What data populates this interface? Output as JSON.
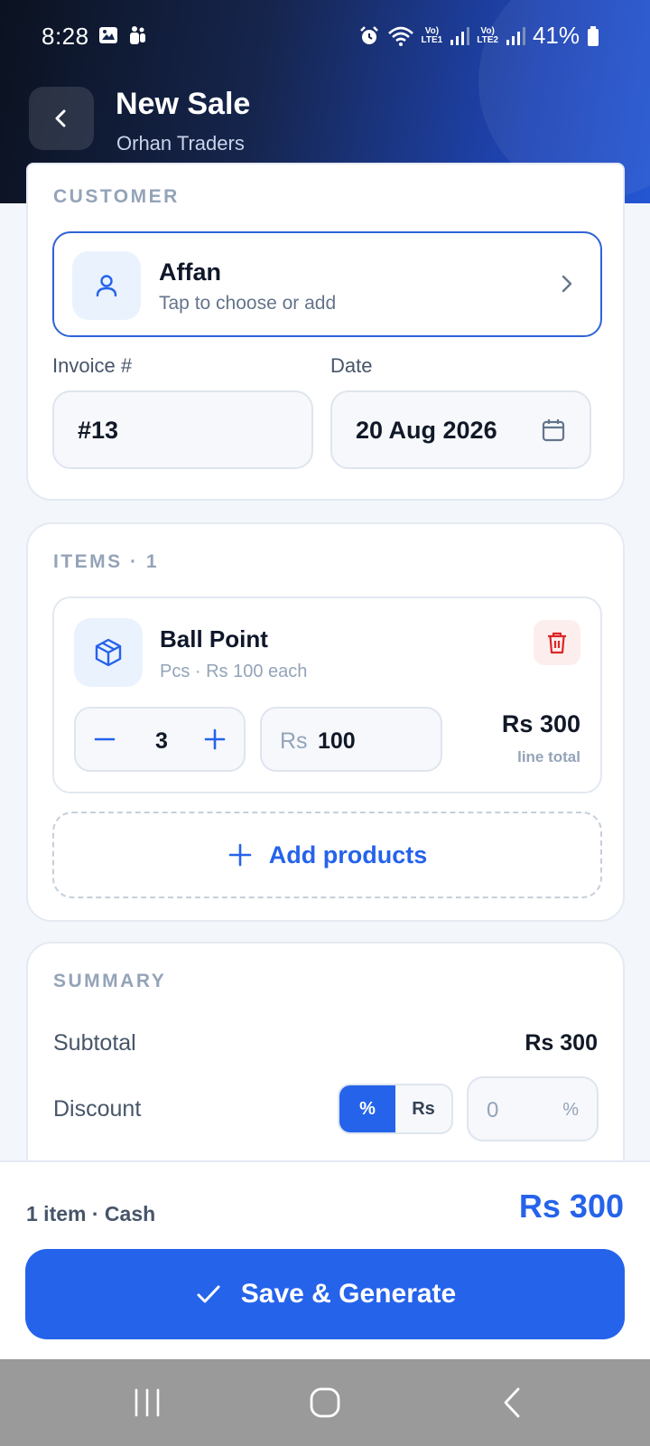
{
  "status_bar": {
    "time": "8:28",
    "battery": "41%",
    "sim1_label": "LTE1",
    "sim2_label": "LTE2"
  },
  "header": {
    "title": "New Sale",
    "subtitle": "Orhan Traders",
    "back_icon": "chevron-left-icon"
  },
  "customer": {
    "section_label": "CUSTOMER",
    "name": "Affan",
    "hint": "Tap to choose or add",
    "icon": "user-icon"
  },
  "invoice": {
    "invoice_label": "Invoice #",
    "invoice_value": "#13",
    "date_label": "Date",
    "date_value": "20 Aug 2026"
  },
  "items": {
    "section_label": "ITEMS · 1",
    "list": [
      {
        "name": "Ball Point",
        "meta": "Pcs · Rs 100 each",
        "quantity": "3",
        "currency": "Rs",
        "price": "100",
        "line_total": "Rs 300",
        "line_total_label": "line total"
      }
    ],
    "add_products_label": "Add products"
  },
  "summary": {
    "section_label": "SUMMARY",
    "subtotal_label": "Subtotal",
    "subtotal_value": "Rs 300",
    "discount_label": "Discount",
    "discount_mode_options": [
      "%",
      "Rs"
    ],
    "discount_mode_selected": "%",
    "discount_value": "0",
    "discount_unit": "%"
  },
  "footer": {
    "info": "1 item · Cash",
    "total": "Rs 300",
    "save_label": "Save & Generate"
  },
  "colors": {
    "accent": "#2563eb",
    "danger": "#dc2626",
    "header_dark": "#0b1220"
  }
}
